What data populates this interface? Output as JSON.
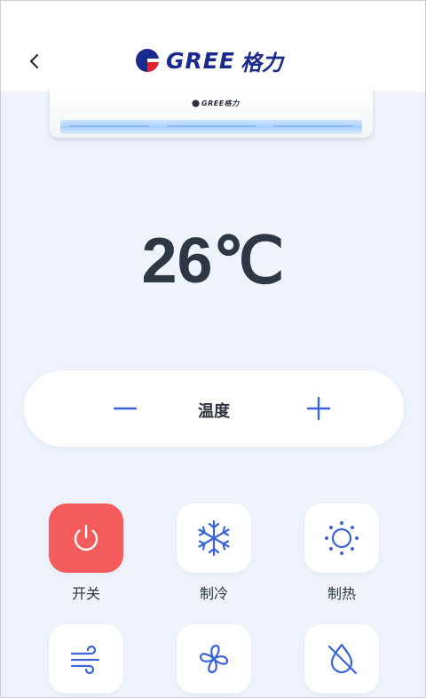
{
  "header": {
    "back_icon": "chevron-left-icon",
    "logo_text": "GREE",
    "logo_script": "格力"
  },
  "ac_unit": {
    "brand_label": "GREE格力"
  },
  "temperature": {
    "display": "26℃"
  },
  "temp_control": {
    "label": "温度",
    "decrease_icon": "minus-icon",
    "increase_icon": "plus-icon"
  },
  "modes": [
    {
      "label": "开关",
      "icon": "power-icon",
      "active": true
    },
    {
      "label": "制冷",
      "icon": "snowflake-icon",
      "active": false
    },
    {
      "label": "制热",
      "icon": "sun-icon",
      "active": false
    },
    {
      "label": "",
      "icon": "wind-icon",
      "active": false
    },
    {
      "label": "",
      "icon": "fan-icon",
      "active": false
    },
    {
      "label": "",
      "icon": "dehumidify-icon",
      "active": false
    }
  ],
  "colors": {
    "accent": "#3a63d8",
    "power_active": "#f45b5b",
    "background": "#eef3fc"
  }
}
